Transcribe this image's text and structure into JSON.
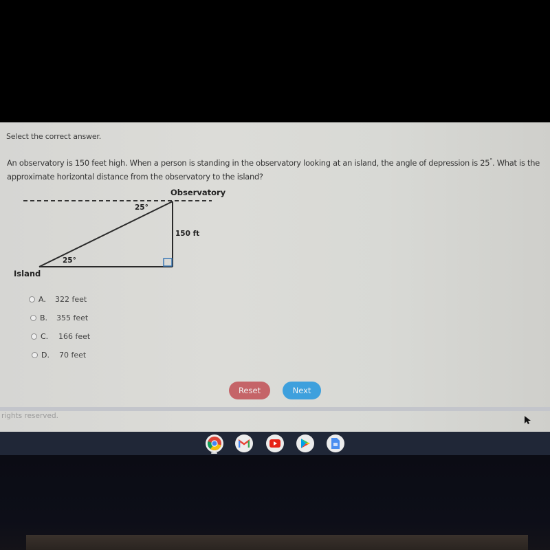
{
  "instruction": "Select the correct answer.",
  "question": {
    "part1": "An observatory is 150 feet high. When a person is standing in the observatory looking at an island, the angle of depression is 25",
    "degree": "°",
    "part2": ". What is the approximate horizontal distance from the observatory to the island?"
  },
  "diagram": {
    "observatory_label": "Observatory",
    "island_label": "Island",
    "height_label": "150 ft",
    "top_angle_label": "25°",
    "bottom_angle_label": "25°"
  },
  "options": [
    {
      "letter": "A.",
      "text": "322 feet"
    },
    {
      "letter": "B.",
      "text": "355 feet"
    },
    {
      "letter": "C.",
      "text": "166 feet"
    },
    {
      "letter": "D.",
      "text": "70 feet"
    }
  ],
  "buttons": {
    "reset": "Reset",
    "next": "Next"
  },
  "colors": {
    "reset": "#c56468",
    "next": "#3ea0dd"
  },
  "footer": "rights reserved.",
  "shelf": {
    "apps": [
      "chrome-icon",
      "gmail-icon",
      "youtube-icon",
      "play-store-icon",
      "docs-icon"
    ]
  }
}
